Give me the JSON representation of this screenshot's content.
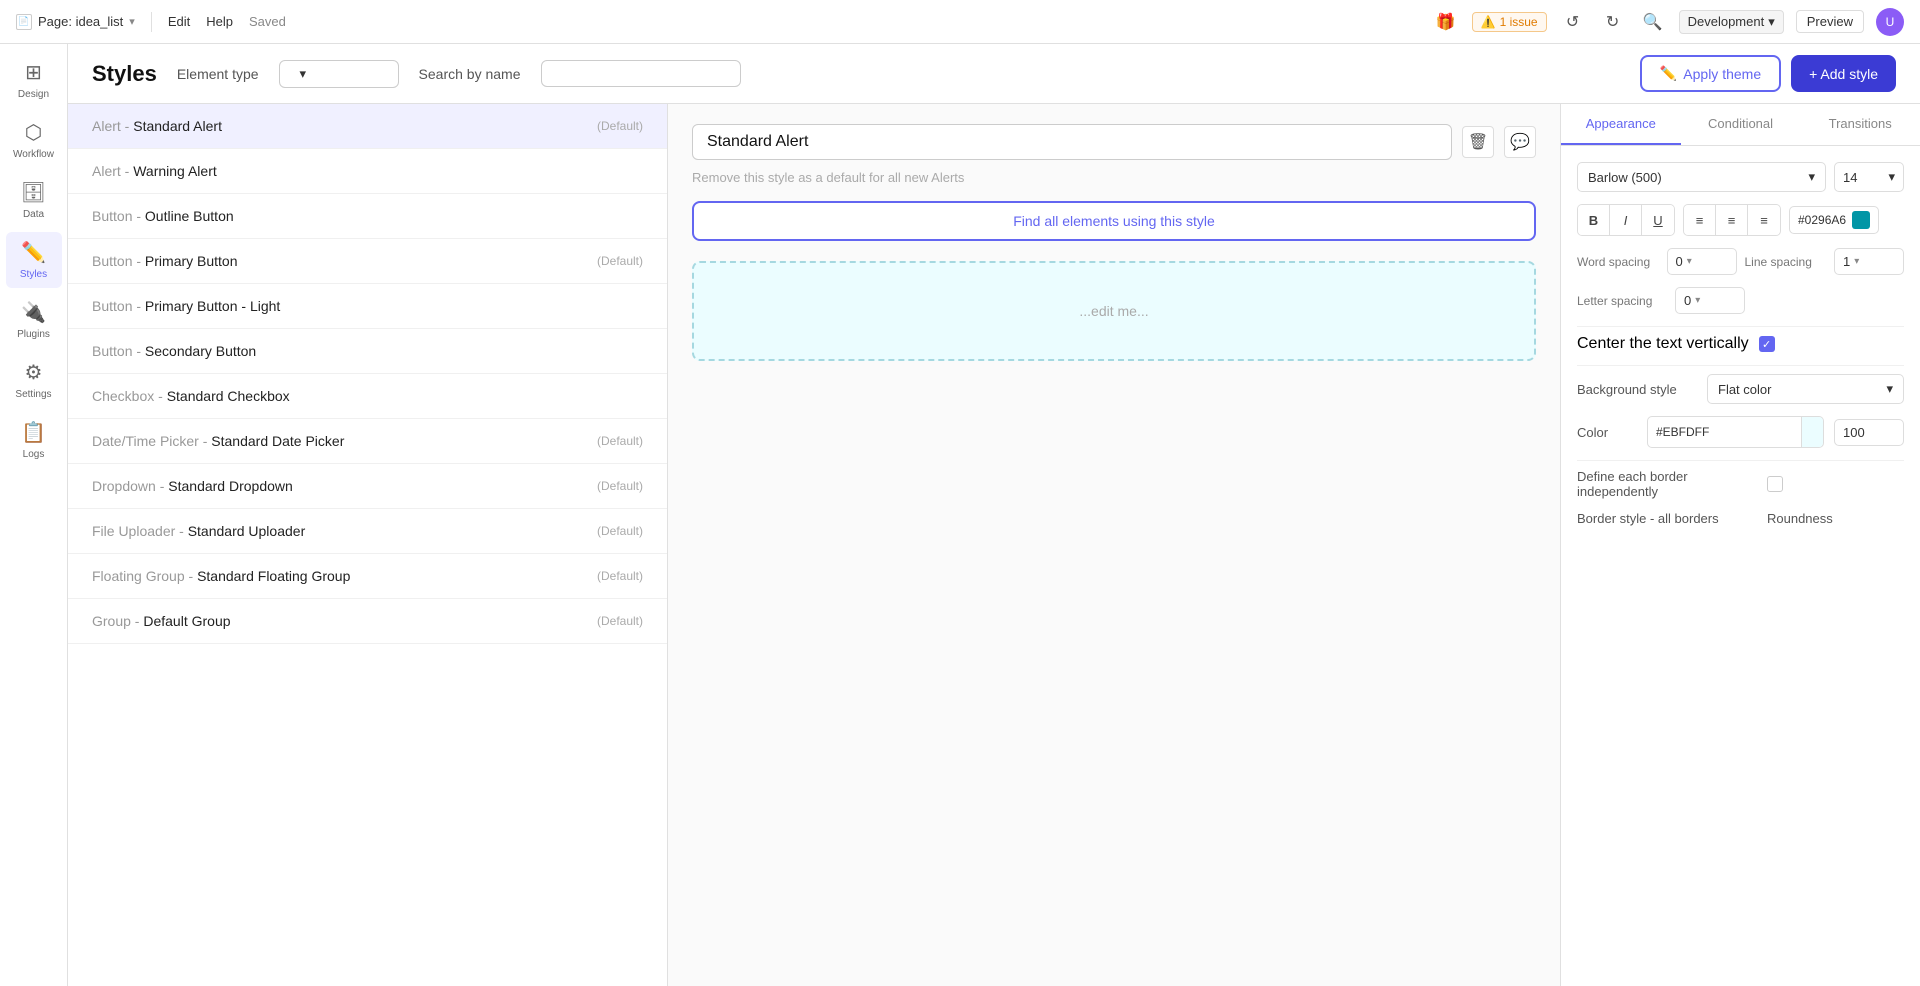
{
  "topbar": {
    "page_icon": "📄",
    "page_name": "Page: idea_list",
    "chevron": "▾",
    "nav_items": [
      "Edit",
      "Help"
    ],
    "saved_label": "Saved",
    "issue_label": "1 issue",
    "env_label": "Development",
    "preview_label": "Preview",
    "undo_icon": "↺",
    "redo_icon": "↻",
    "search_icon": "🔍",
    "gift_icon": "🎁"
  },
  "sidebar": {
    "items": [
      {
        "id": "design",
        "label": "Design",
        "icon": "⊞"
      },
      {
        "id": "workflow",
        "label": "Workflow",
        "icon": "⬡"
      },
      {
        "id": "data",
        "label": "Data",
        "icon": "🗄"
      },
      {
        "id": "styles",
        "label": "Styles",
        "icon": "✏️",
        "active": true
      },
      {
        "id": "plugins",
        "label": "Plugins",
        "icon": "🔌"
      },
      {
        "id": "settings",
        "label": "Settings",
        "icon": "⚙"
      },
      {
        "id": "logs",
        "label": "Logs",
        "icon": "📋"
      }
    ]
  },
  "header": {
    "title": "Styles",
    "element_type_label": "Element type",
    "element_type_placeholder": "",
    "search_label": "Search by name",
    "search_placeholder": "",
    "apply_theme_label": "Apply theme",
    "add_style_label": "+ Add style"
  },
  "styles_list": {
    "items": [
      {
        "id": 1,
        "category": "Alert",
        "name": "Standard Alert",
        "default": "(Default)",
        "selected": true
      },
      {
        "id": 2,
        "category": "Alert",
        "name": "Warning Alert",
        "default": ""
      },
      {
        "id": 3,
        "category": "Button",
        "name": "Outline Button",
        "default": ""
      },
      {
        "id": 4,
        "category": "Button",
        "name": "Primary Button",
        "default": "(Default)"
      },
      {
        "id": 5,
        "category": "Button",
        "name": "Primary Button - Light",
        "default": ""
      },
      {
        "id": 6,
        "category": "Button",
        "name": "Secondary Button",
        "default": ""
      },
      {
        "id": 7,
        "category": "Checkbox",
        "name": "Standard Checkbox",
        "default": ""
      },
      {
        "id": 8,
        "category": "Date/Time Picker",
        "name": "Standard Date Picker",
        "default": "(Default)"
      },
      {
        "id": 9,
        "category": "Dropdown",
        "name": "Standard Dropdown",
        "default": "(Default)"
      },
      {
        "id": 10,
        "category": "File Uploader",
        "name": "Standard Uploader",
        "default": "(Default)"
      },
      {
        "id": 11,
        "category": "Floating Group",
        "name": "Standard Floating Group",
        "default": "(Default)"
      },
      {
        "id": 12,
        "category": "Group",
        "name": "Default Group",
        "default": "(Default)"
      }
    ]
  },
  "detail": {
    "style_name": "Standard Alert",
    "remove_default_text": "Remove this style as a default for all new Alerts",
    "find_elements_label": "Find all elements using this style",
    "preview_placeholder": "...edit me..."
  },
  "properties": {
    "tabs": [
      "Appearance",
      "Conditional",
      "Transitions"
    ],
    "active_tab": "Appearance",
    "font": {
      "family": "Barlow (500)",
      "size": "14"
    },
    "bold_label": "B",
    "italic_label": "I",
    "underline_label": "U",
    "align_left": "≡",
    "align_center": "≡",
    "align_right": "≡",
    "color_hex": "#0296A6",
    "word_spacing_label": "Word spacing",
    "word_spacing_value": "0",
    "line_spacing_label": "Line spacing",
    "line_spacing_value": "1",
    "letter_spacing_label": "Letter spacing",
    "letter_spacing_value": "0",
    "center_text_label": "Center the text vertically",
    "center_text_checked": true,
    "bg_style_label": "Background style",
    "bg_style_value": "Flat color",
    "color_label": "Color",
    "color_value": "#EBFDFF",
    "opacity_value": "100",
    "border_label": "Define each border independently",
    "border_style_label": "Border style - all borders",
    "roundness_label": "Roundness"
  }
}
